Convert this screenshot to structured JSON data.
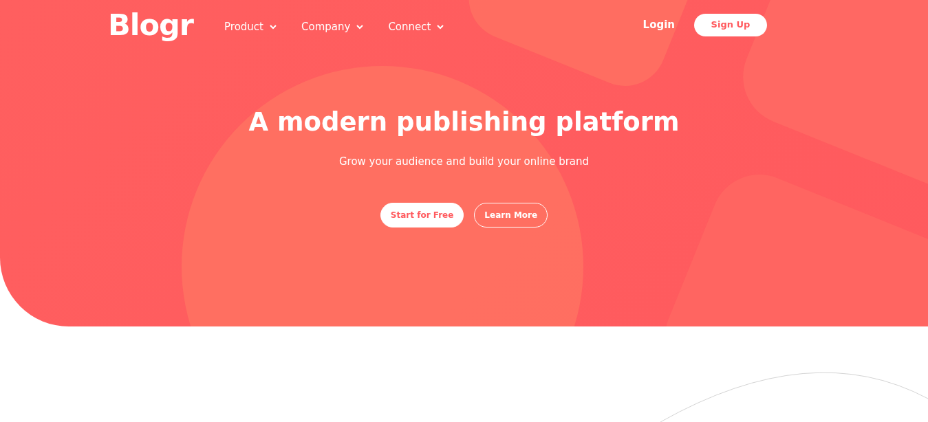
{
  "header": {
    "logo": "Blogr",
    "nav_items": [
      {
        "label": "Product",
        "dropdown": true
      },
      {
        "label": "Company",
        "dropdown": true
      },
      {
        "label": "Connect",
        "dropdown": true
      }
    ],
    "login": "Login",
    "signup": "Sign Up"
  },
  "hero": {
    "title": "A modern publishing platform",
    "subtitle": "Grow your audience and build your online brand",
    "buttons": [
      {
        "label": "Start for Free",
        "kind": "solid"
      },
      {
        "label": "Learn More",
        "kind": "outline"
      }
    ]
  }
}
